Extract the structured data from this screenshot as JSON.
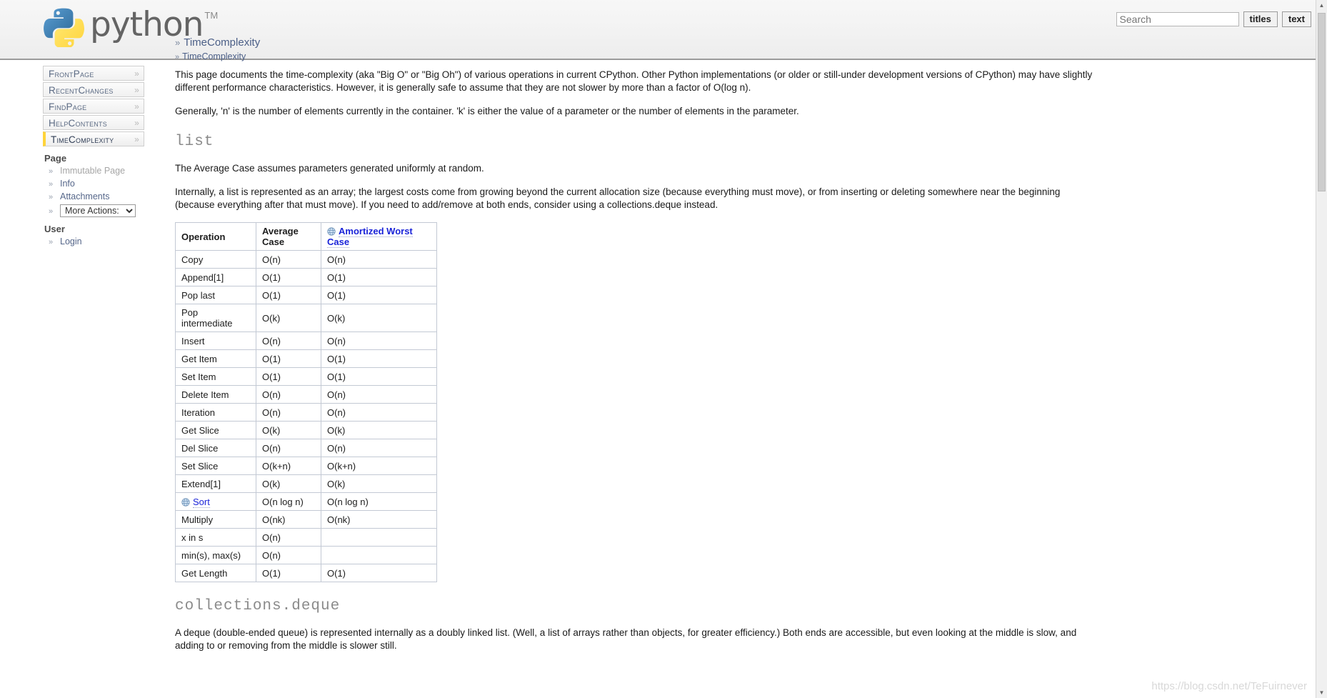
{
  "header": {
    "logo_word": "python",
    "logo_tm": "TM",
    "logo_icon": "python-logo",
    "colors": {
      "python_blue": "#3873A4",
      "python_yellow": "#FFD43B",
      "accent": "#FFD43B",
      "link_blue": "#1A23D8"
    }
  },
  "search": {
    "placeholder": "Search",
    "value": "",
    "titles_label": "titles",
    "text_label": "text"
  },
  "breadcrumb_top": {
    "chevron": "»",
    "label": "TimeComplexity"
  },
  "breadcrumb_sub": {
    "chevron": "»",
    "label": "TimeComplexity"
  },
  "sidebar": {
    "nav": [
      {
        "label": "FrontPage",
        "active": false,
        "chevron": "»"
      },
      {
        "label": "RecentChanges",
        "active": false,
        "chevron": "»"
      },
      {
        "label": "FindPage",
        "active": false,
        "chevron": "»"
      },
      {
        "label": "HelpContents",
        "active": false,
        "chevron": "»"
      },
      {
        "label": "TimeComplexity",
        "active": true,
        "chevron": "»"
      }
    ],
    "page_heading": "Page",
    "page_links": [
      {
        "label": "Immutable Page",
        "muted": true
      },
      {
        "label": "Info",
        "muted": false
      },
      {
        "label": "Attachments",
        "muted": false
      }
    ],
    "more_actions": {
      "label": "More Actions:",
      "caret": "▼"
    },
    "user_heading": "User",
    "user_links": [
      {
        "label": "Login",
        "muted": false
      }
    ],
    "bullet": "»"
  },
  "main": {
    "intro_p1": "This page documents the time-complexity (aka \"Big O\" or \"Big Oh\") of various operations in current CPython. Other Python implementations (or older or still-under development versions of CPython) may have slightly different performance characteristics. However, it is generally safe to assume that they are not slower by more than a factor of O(log n).",
    "intro_p2": "Generally, 'n' is the number of elements currently in the container. 'k' is either the value of a parameter or the number of elements in the parameter.",
    "list_heading": "list",
    "list_p1": "The Average Case assumes parameters generated uniformly at random.",
    "list_p2": "Internally, a list is represented as an array; the largest costs come from growing beyond the current allocation size (because everything must move), or from inserting or deleting somewhere near the beginning (because everything after that must move). If you need to add/remove at both ends, consider using a collections.deque instead.",
    "deque_heading": "collections.deque",
    "deque_p1": "A deque (double-ended queue) is represented internally as a doubly linked list. (Well, a list of arrays rather than objects, for greater efficiency.) Both ends are accessible, but even looking at the middle is slow, and adding to or removing from the middle is slower still."
  },
  "table_data": {
    "type": "table",
    "columns": [
      "Operation",
      "Average Case",
      "Amortized Worst Case"
    ],
    "worst_case_header_is_link": true,
    "worst_case_header_icon": "globe-icon",
    "rows": [
      {
        "operation": "Copy",
        "average": "O(n)",
        "worst": "O(n)",
        "link": false
      },
      {
        "operation": "Append[1]",
        "average": "O(1)",
        "worst": "O(1)",
        "link": false
      },
      {
        "operation": "Pop last",
        "average": "O(1)",
        "worst": "O(1)",
        "link": false
      },
      {
        "operation": "Pop intermediate",
        "average": "O(k)",
        "worst": "O(k)",
        "link": false
      },
      {
        "operation": "Insert",
        "average": "O(n)",
        "worst": "O(n)",
        "link": false
      },
      {
        "operation": "Get Item",
        "average": "O(1)",
        "worst": "O(1)",
        "link": false
      },
      {
        "operation": "Set Item",
        "average": "O(1)",
        "worst": "O(1)",
        "link": false
      },
      {
        "operation": "Delete Item",
        "average": "O(n)",
        "worst": "O(n)",
        "link": false
      },
      {
        "operation": "Iteration",
        "average": "O(n)",
        "worst": "O(n)",
        "link": false
      },
      {
        "operation": "Get Slice",
        "average": "O(k)",
        "worst": "O(k)",
        "link": false
      },
      {
        "operation": "Del Slice",
        "average": "O(n)",
        "worst": "O(n)",
        "link": false
      },
      {
        "operation": "Set Slice",
        "average": "O(k+n)",
        "worst": "O(k+n)",
        "link": false
      },
      {
        "operation": "Extend[1]",
        "average": "O(k)",
        "worst": "O(k)",
        "link": false
      },
      {
        "operation": "Sort",
        "average": "O(n log n)",
        "worst": "O(n log n)",
        "link": true
      },
      {
        "operation": "Multiply",
        "average": "O(nk)",
        "worst": "O(nk)",
        "link": false
      },
      {
        "operation": "x in s",
        "average": "O(n)",
        "worst": "",
        "link": false
      },
      {
        "operation": "min(s), max(s)",
        "average": "O(n)",
        "worst": "",
        "link": false
      },
      {
        "operation": "Get Length",
        "average": "O(1)",
        "worst": "O(1)",
        "link": false
      }
    ]
  },
  "watermark": "https://blog.csdn.net/TeFuirnever",
  "scrollbar": {
    "up_arrow": "▲",
    "down_arrow": "▼"
  }
}
